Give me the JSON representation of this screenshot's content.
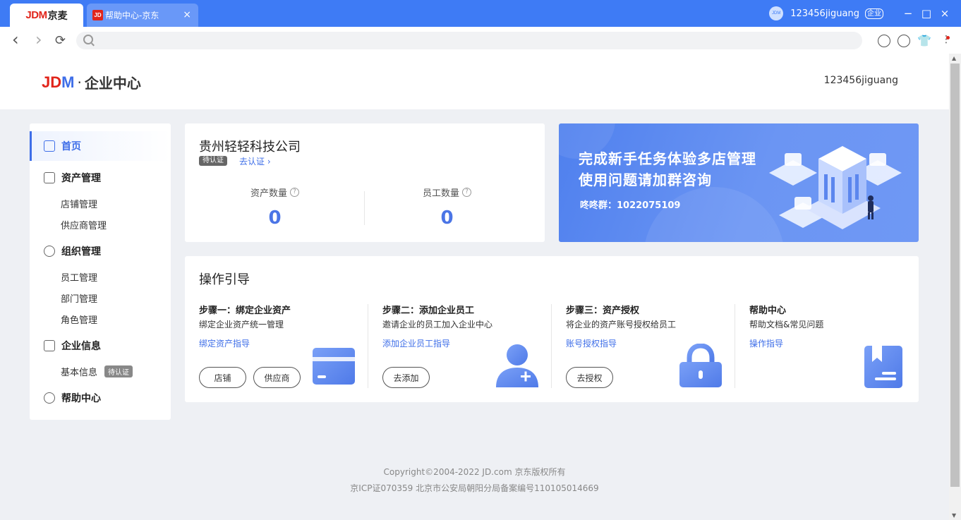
{
  "browser": {
    "tabs": [
      {
        "logo_latin": "JDM",
        "logo_cn": "京麦"
      },
      {
        "favicon": "JD",
        "label": "帮助中心-京东",
        "close": "×"
      }
    ],
    "avatar_text": "JDM",
    "user": "123456jiguang",
    "user_badge": "企业",
    "window_controls": {
      "minimize": "−",
      "maximize": "□",
      "close": "×"
    },
    "nav": {
      "back": "‹",
      "forward": "›",
      "reload": "⟳"
    },
    "address_value": ""
  },
  "header": {
    "brand_j": "J",
    "brand_d": "D",
    "brand_m": "M",
    "brand_dot": "·",
    "brand_text": "企业中心",
    "username": "123456jiguang"
  },
  "sidebar": {
    "items": [
      {
        "label": "首页",
        "icon": "home-icon"
      },
      {
        "label": "资产管理",
        "icon": "wallet-icon"
      },
      {
        "label": "组织管理",
        "icon": "user-icon"
      },
      {
        "label": "企业信息",
        "icon": "document-icon"
      },
      {
        "label": "帮助中心",
        "icon": "help-icon"
      }
    ],
    "sub_items": {
      "assets": [
        "店铺管理",
        "供应商管理"
      ],
      "org": [
        "员工管理",
        "部门管理",
        "角色管理"
      ],
      "info": [
        "基本信息"
      ]
    },
    "info_badge": "待认证"
  },
  "company": {
    "name": "贵州轻轻科技公司",
    "cert_status": "待认证",
    "cert_link": "去认证 ›",
    "stats": [
      {
        "label": "资产数量",
        "value": "0"
      },
      {
        "label": "员工数量",
        "value": "0"
      }
    ],
    "help_glyph": "?"
  },
  "banner": {
    "line1": "完成新手任务体验多店管理",
    "line2": "使用问题请加群咨询",
    "group": "咚咚群：1022075109"
  },
  "guide": {
    "title": "操作引导",
    "steps": [
      {
        "title": "步骤一：绑定企业资产",
        "desc": "绑定企业资产统一管理",
        "link": "绑定资产指导",
        "buttons": [
          "店铺",
          "供应商"
        ],
        "icon": "card-icon"
      },
      {
        "title": "步骤二：添加企业员工",
        "desc": "邀请企业的员工加入企业中心",
        "link": "添加企业员工指导",
        "buttons": [
          "去添加"
        ],
        "icon": "add-user-icon"
      },
      {
        "title": "步骤三：资产授权",
        "desc": "将企业的资产账号授权给员工",
        "link": "账号授权指导",
        "buttons": [
          "去授权"
        ],
        "icon": "lock-icon"
      },
      {
        "title": "帮助中心",
        "desc": "帮助文档&常见问题",
        "link": "操作指导",
        "buttons": [],
        "icon": "bookmark-doc-icon"
      }
    ]
  },
  "footer": {
    "copyright": "Copyright©2004-2022 JD.com 京东版权所有",
    "icp": "京ICP证070359 北京市公安局朝阳分局备案编号110105014669"
  },
  "colors": {
    "brand_blue": "#3e7bf5",
    "accent_blue": "#3e6ee8",
    "brand_red": "#e1251b",
    "page_bg": "#eef0f4"
  }
}
